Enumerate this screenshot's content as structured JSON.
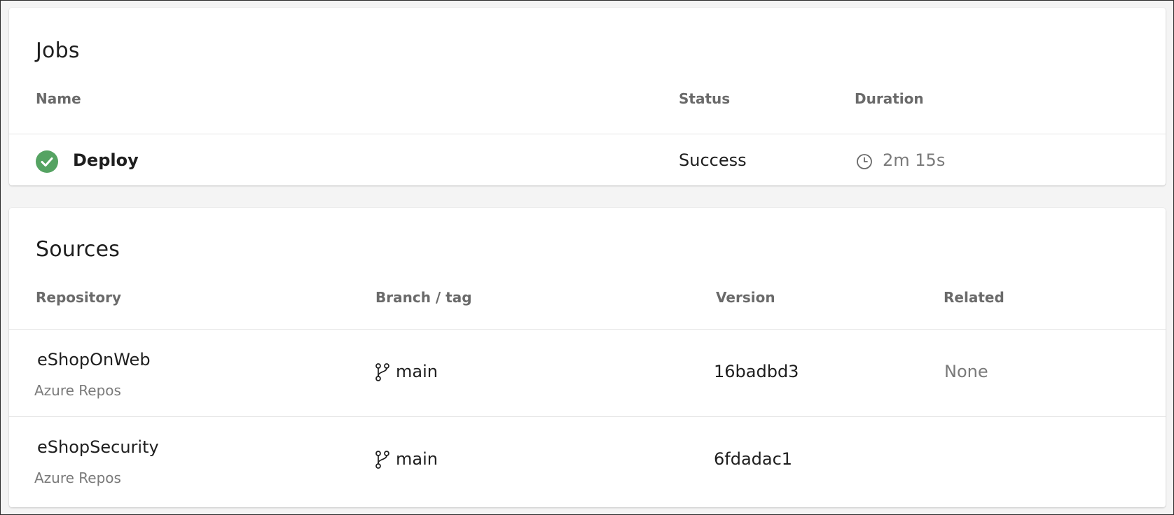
{
  "jobs": {
    "title": "Jobs",
    "columns": {
      "name": "Name",
      "status": "Status",
      "duration": "Duration"
    },
    "rows": [
      {
        "name": "Deploy",
        "status": "Success",
        "duration": "2m 15s",
        "status_icon": "success-check-icon",
        "duration_icon": "clock-icon"
      }
    ]
  },
  "sources": {
    "title": "Sources",
    "columns": {
      "repository": "Repository",
      "branch": "Branch / tag",
      "version": "Version",
      "related": "Related"
    },
    "rows": [
      {
        "repository": "eShopOnWeb",
        "provider": "Azure Repos",
        "branch": "main",
        "branch_icon": "branch-icon",
        "version": "16badbd3",
        "related": "None"
      },
      {
        "repository": "eShopSecurity",
        "provider": "Azure Repos",
        "branch": "main",
        "branch_icon": "branch-icon",
        "version": "6fdadac1",
        "related": ""
      }
    ]
  },
  "colors": {
    "success": "#55a362",
    "header_text": "#6a6a6a",
    "muted_text": "#7a7a7a",
    "divider": "#e4e4e4"
  }
}
